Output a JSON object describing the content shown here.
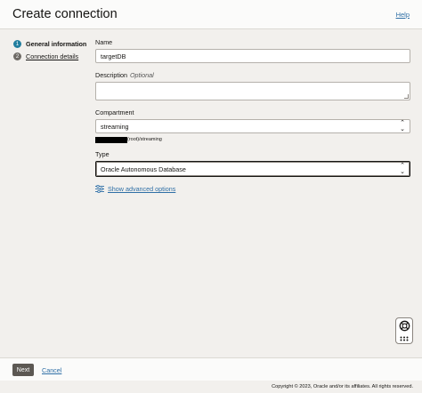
{
  "header": {
    "title": "Create connection",
    "help_label": "Help"
  },
  "steps": [
    {
      "num": "1",
      "label": "General information"
    },
    {
      "num": "2",
      "label": "Connection details"
    }
  ],
  "form": {
    "name": {
      "label": "Name",
      "value": "targetDB"
    },
    "description": {
      "label": "Description",
      "optional": "Optional",
      "value": ""
    },
    "compartment": {
      "label": "Compartment",
      "value": "streaming",
      "path_suffix": "(root)/streaming"
    },
    "type": {
      "label": "Type",
      "value": "Oracle Autonomous Database"
    },
    "advanced_label": "Show advanced options"
  },
  "footer": {
    "next_label": "Next",
    "cancel_label": "Cancel",
    "copyright": "Copyright © 2023, Oracle and/or its affiliates. All rights reserved."
  },
  "colors": {
    "accent": "#227e9e",
    "link": "#2f6fa6",
    "button": "#5c5853"
  }
}
